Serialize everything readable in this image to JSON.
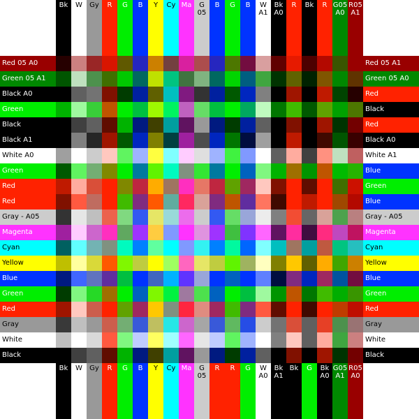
{
  "grid_cols": 19,
  "grid_rows": 19,
  "columns": [
    {
      "top": [
        "Bk"
      ],
      "bottom": [
        "Bk"
      ],
      "top_color": "#000000",
      "bottom_color": "#000000"
    },
    {
      "top": [
        "W"
      ],
      "bottom": [
        "W"
      ],
      "top_color": "#ffffff",
      "bottom_color": "#ffffff"
    },
    {
      "top": [
        "Gy"
      ],
      "bottom": [
        "Gy"
      ],
      "top_color": "#999999",
      "bottom_color": "#999999"
    },
    {
      "top": [
        "R"
      ],
      "bottom": [
        "R"
      ],
      "top_color": "#ff2200",
      "bottom_color": "#ff2200"
    },
    {
      "top": [
        "G"
      ],
      "bottom": [
        "G"
      ],
      "top_color": "#00ee00",
      "bottom_color": "#00ee00"
    },
    {
      "top": [
        "B"
      ],
      "bottom": [
        "B"
      ],
      "top_color": "#0033ff",
      "bottom_color": "#0033ff"
    },
    {
      "top": [
        "Y"
      ],
      "bottom": [
        "Y"
      ],
      "top_color": "#ffff00",
      "bottom_color": "#ffff00"
    },
    {
      "top": [
        "Cy"
      ],
      "bottom": [
        "Cy"
      ],
      "top_color": "#00ffff",
      "bottom_color": "#00ffff"
    },
    {
      "top": [
        "Ma"
      ],
      "bottom": [
        "Ma"
      ],
      "top_color": "#ff33ff",
      "bottom_color": "#ff33ff"
    },
    {
      "top": [
        "G",
        "05"
      ],
      "bottom": [
        "G",
        "05"
      ],
      "top_color": "#cccccc",
      "bottom_color": "#cccccc"
    },
    {
      "top": [
        "B"
      ],
      "bottom": [
        "R"
      ],
      "top_color": "#0033ff",
      "bottom_color": "#ff2200"
    },
    {
      "top": [
        "G"
      ],
      "bottom": [
        "R"
      ],
      "top_color": "#00ee00",
      "bottom_color": "#ff2200"
    },
    {
      "top": [
        "B"
      ],
      "bottom": [
        "G"
      ],
      "top_color": "#0033ff",
      "bottom_color": "#00ee00"
    },
    {
      "top": [
        "W",
        "A1"
      ],
      "bottom": [
        "W",
        "A0"
      ],
      "top_color": "#ffffff",
      "bottom_color": "#ffffff"
    },
    {
      "top": [
        "Bk",
        "A0"
      ],
      "bottom": [
        "Bk",
        "A1"
      ],
      "top_color": "#000000",
      "bottom_color": "#000000"
    },
    {
      "top": [
        "R"
      ],
      "bottom": [
        "Bk"
      ],
      "top_color": "#ff2200",
      "bottom_color": "#000000"
    },
    {
      "top": [
        "Bk"
      ],
      "bottom": [
        "G"
      ],
      "top_color": "#000000",
      "bottom_color": "#00ee00"
    },
    {
      "top": [
        "R"
      ],
      "bottom": [
        "Bk",
        "A0"
      ],
      "top_color": "#ff2200",
      "bottom_color": "#000000"
    },
    {
      "top": [
        "G05",
        "A0"
      ],
      "bottom": [
        "G05",
        "A1"
      ],
      "top_color": "#008800",
      "bottom_color": "#008800"
    },
    {
      "top": [
        "R05",
        "A1"
      ],
      "bottom": [
        "R05",
        "A0"
      ],
      "top_color": "#990000",
      "bottom_color": "#990000"
    }
  ],
  "rows": [
    {
      "left": "Red 05 A0",
      "right": "Red 05 A1",
      "left_color": "#990000",
      "right_color": "#990000"
    },
    {
      "left": "Green 05 A1",
      "right": "Green 05 A0",
      "left_color": "#008800",
      "right_color": "#008800"
    },
    {
      "left": "Black A0",
      "right": "Red",
      "left_color": "#000000",
      "right_color": "#ff2200"
    },
    {
      "left": "Green",
      "right": "Black",
      "left_color": "#00ee00",
      "right_color": "#000000"
    },
    {
      "left": "Black",
      "right": "Red",
      "left_color": "#000000",
      "right_color": "#ff2200"
    },
    {
      "left": "Black A1",
      "right": "Black A0",
      "left_color": "#000000",
      "right_color": "#000000"
    },
    {
      "left": "White A0",
      "right": "White A1",
      "left_color": "#ffffff",
      "right_color": "#ffffff"
    },
    {
      "left": "Green",
      "right": "Blue",
      "left_color": "#00ee00",
      "right_color": "#0033ff"
    },
    {
      "left": "Red",
      "right": "Green",
      "left_color": "#ff2200",
      "right_color": "#00ee00"
    },
    {
      "left": "Red",
      "right": "Blue",
      "left_color": "#ff2200",
      "right_color": "#0033ff"
    },
    {
      "left": "Gray - A05",
      "right": "Gray - A05",
      "left_color": "#cccccc",
      "right_color": "#cccccc"
    },
    {
      "left": "Magenta",
      "right": "Magenta",
      "left_color": "#ff33ff",
      "right_color": "#ff33ff"
    },
    {
      "left": "Cyan",
      "right": "Cyan",
      "left_color": "#00ffff",
      "right_color": "#00ffff"
    },
    {
      "left": "Yellow",
      "right": "Yellow",
      "left_color": "#ffff00",
      "right_color": "#ffff00"
    },
    {
      "left": "Blue",
      "right": "Blue",
      "left_color": "#0033ff",
      "right_color": "#0033ff"
    },
    {
      "left": "Green",
      "right": "Green",
      "left_color": "#00ee00",
      "right_color": "#00ee00"
    },
    {
      "left": "Red",
      "right": "Red",
      "left_color": "#ff2200",
      "right_color": "#ff2200"
    },
    {
      "left": "Gray",
      "right": "Gray",
      "left_color": "#999999",
      "right_color": "#999999"
    },
    {
      "left": "White",
      "right": "White",
      "left_color": "#ffffff",
      "right_color": "#ffffff"
    },
    {
      "left": "Black",
      "right": "Black",
      "left_color": "#000000",
      "right_color": "#000000"
    }
  ],
  "colors": {
    "background": "#ffffff",
    "label_text_light": "#ffffff",
    "label_text_dark": "#000000"
  }
}
